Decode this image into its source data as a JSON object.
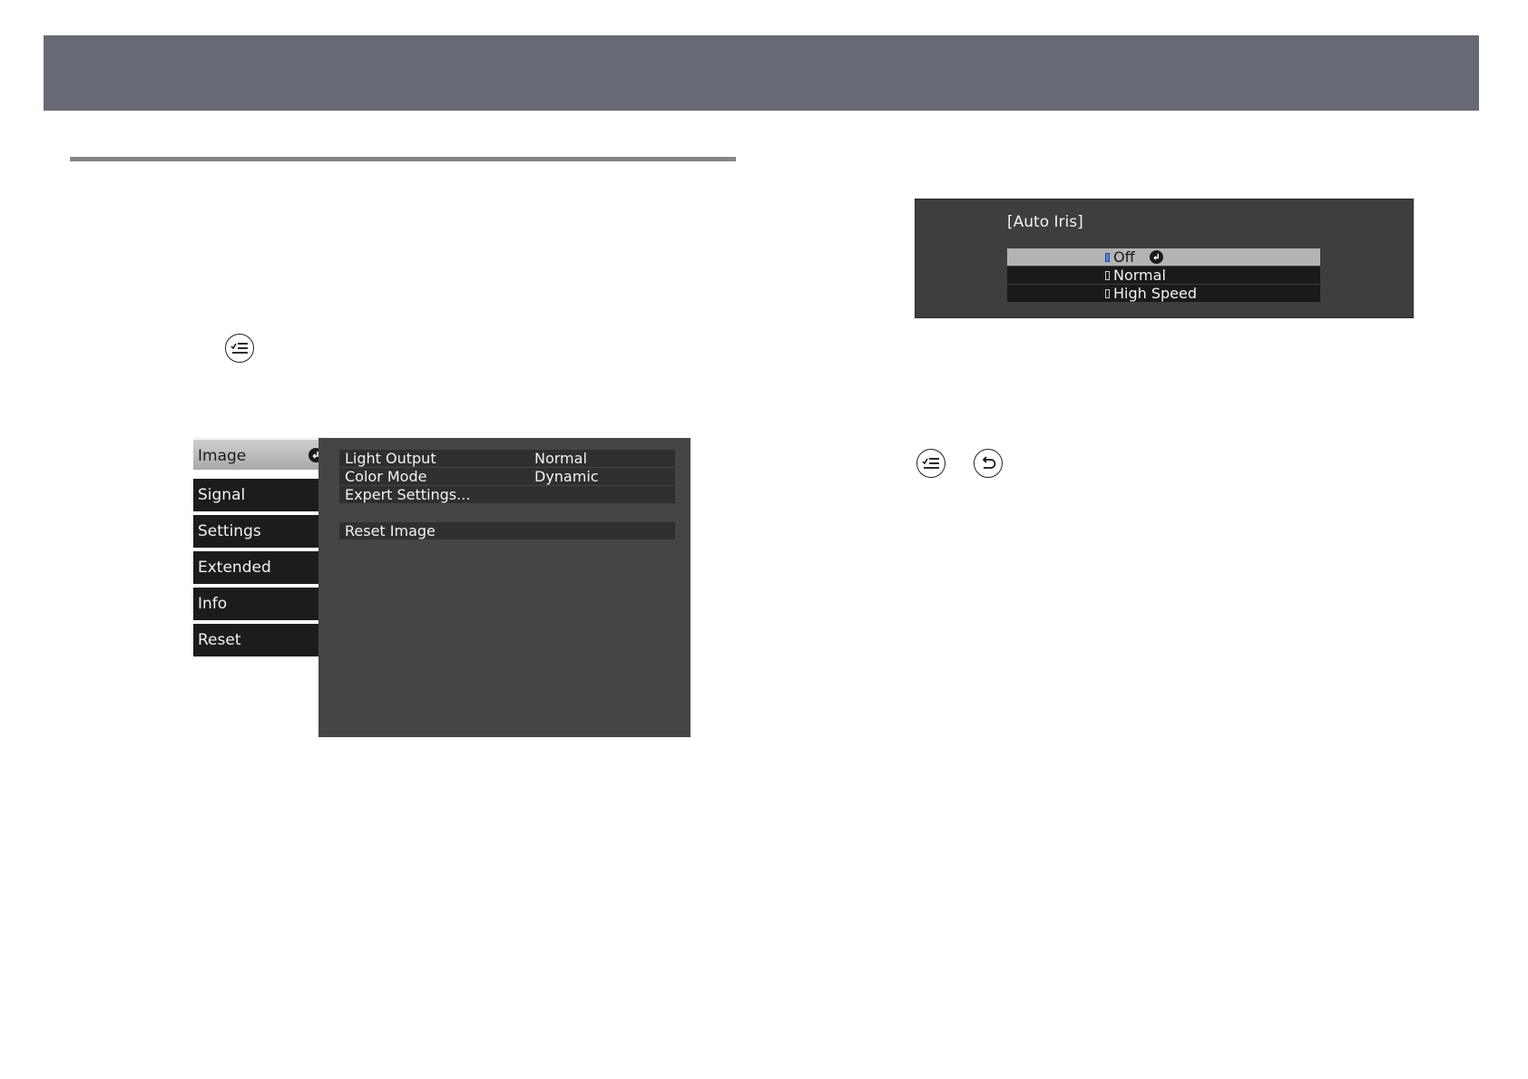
{
  "osd_menu": {
    "tabs": [
      {
        "label": "Image",
        "active": true
      },
      {
        "label": "Signal",
        "active": false
      },
      {
        "label": "Settings",
        "active": false
      },
      {
        "label": "Extended",
        "active": false
      },
      {
        "label": "Info",
        "active": false
      },
      {
        "label": "Reset",
        "active": false
      }
    ],
    "items": [
      {
        "label": "Light Output",
        "value": "Normal"
      },
      {
        "label": "Color Mode",
        "value": "Dynamic"
      },
      {
        "label": "Expert Settings...",
        "value": ""
      }
    ],
    "reset_item": {
      "label": "Reset Image"
    }
  },
  "auto_iris": {
    "title": "[Auto Iris]",
    "options": [
      {
        "label": "Off",
        "selected": true
      },
      {
        "label": "Normal",
        "selected": false
      },
      {
        "label": "High Speed",
        "selected": false
      }
    ]
  },
  "icons": {
    "menu_button": "menu-icon",
    "back_button": "back-icon",
    "enter": "enter-icon"
  },
  "colors": {
    "banner": "#676a74",
    "menu_panel": "#454548",
    "tab_active": "#b4b4b4",
    "tab_inactive": "#1c1c1c"
  }
}
